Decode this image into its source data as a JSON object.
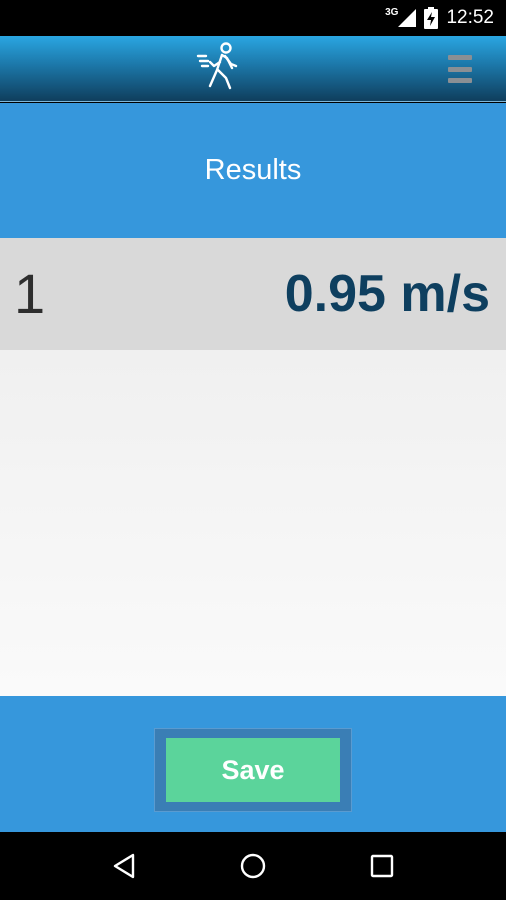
{
  "status_bar": {
    "network_type": "3G",
    "time": "12:52",
    "icons": [
      "signal-icon",
      "battery-charging-icon"
    ]
  },
  "app_bar": {
    "logo_icon": "walking-person-icon",
    "menu_icon": "hamburger-menu-icon"
  },
  "results": {
    "title": "Results",
    "rows": [
      {
        "index": "1",
        "speed": "0.95 m/s"
      }
    ]
  },
  "actions": {
    "save_label": "Save"
  },
  "nav_bar": {
    "icons": [
      "back-icon",
      "home-icon",
      "recents-icon"
    ]
  },
  "colors": {
    "header_blue": "#3697dc",
    "speed_text": "#0e3f5f",
    "save_green": "#5bd49b",
    "row_gray": "#d9d9d9"
  }
}
